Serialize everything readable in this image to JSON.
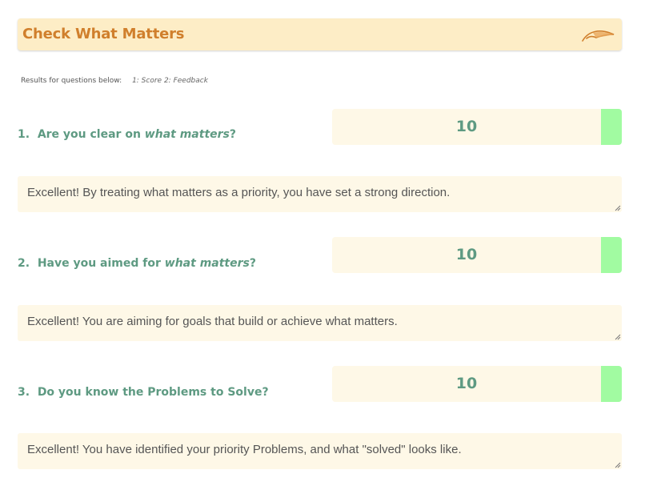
{
  "header": {
    "title": "Check What Matters",
    "icon": "feather-icon",
    "background": "#fdedc6",
    "title_color": "#d07f2c"
  },
  "results_note": {
    "label": "Results for questions below:",
    "legend": "1: Score  2: Feedback"
  },
  "questions": [
    {
      "number": "1.",
      "prefix": "Are you clear on ",
      "emphasis": "what matters",
      "suffix": "?",
      "score": "10",
      "feedback": "Excellent! By treating what matters as a priority, you have set a strong direction."
    },
    {
      "number": "2.",
      "prefix": "Have you aimed for ",
      "emphasis": "what matters",
      "suffix": "?",
      "score": "10",
      "feedback": "Excellent! You are aiming for goals that build or achieve what matters."
    },
    {
      "number": "3.",
      "prefix": "Do you know the Problems to Solve?",
      "emphasis": "",
      "suffix": "",
      "score": "10",
      "feedback": "Excellent! You have identified your priority Problems, and what \"solved\" looks like."
    }
  ],
  "colors": {
    "question_text": "#5e9a82",
    "score_box": "#fef8e7",
    "score_good": "#a1fba1",
    "feedback_text": "#555555"
  }
}
